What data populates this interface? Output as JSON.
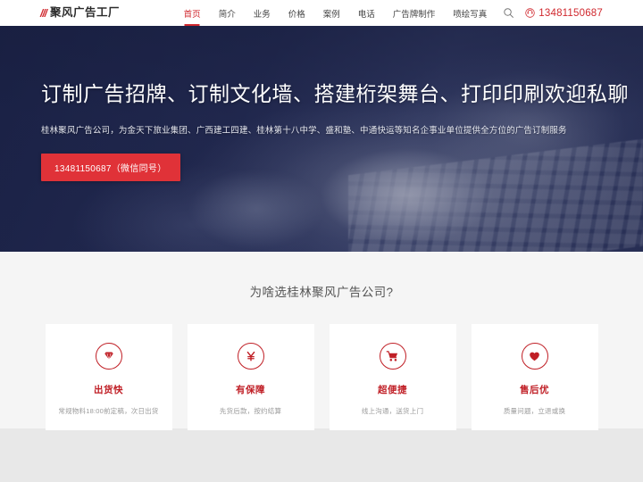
{
  "header": {
    "logo": {
      "mark": "///",
      "mark_icon": "logo-mark-icon",
      "text": "聚风广告工厂"
    },
    "nav": [
      {
        "label": "首页",
        "active": true
      },
      {
        "label": "简介",
        "active": false
      },
      {
        "label": "业务",
        "active": false
      },
      {
        "label": "价格",
        "active": false
      },
      {
        "label": "案例",
        "active": false
      },
      {
        "label": "电话",
        "active": false
      },
      {
        "label": "广告牌制作",
        "active": false
      },
      {
        "label": "喷绘写真",
        "active": false
      }
    ],
    "search_icon": "search-icon",
    "phone_icon": "phone-icon",
    "phone": "13481150687",
    "accent_color": "#d0282e"
  },
  "hero": {
    "title": "订制广告招牌、订制文化墙、搭建桁架舞台、打印印刷欢迎私聊",
    "subtitle": "桂林聚风广告公司，为金天下旅业集团、广西建工四建、桂林第十八中学、盛和塾、中通快运等知名企事业单位提供全方位的广告订制服务",
    "cta_label": "13481150687（微信同号）",
    "cta_color": "#e03238",
    "background_color": "#232a52"
  },
  "features": {
    "title": "为啥选桂林聚风广告公司?",
    "accent_color": "#c01f26",
    "cards": [
      {
        "icon": "diamond-icon",
        "title": "出货快",
        "desc": "常规物料18:00前定稿，次日出货"
      },
      {
        "icon": "yen-icon",
        "title": "有保障",
        "desc": "先货后款，按约结算"
      },
      {
        "icon": "shopping-cart-icon",
        "title": "超便捷",
        "desc": "线上沟通，送货上门"
      },
      {
        "icon": "heart-icon",
        "title": "售后优",
        "desc": "质量问题，立退或换"
      }
    ]
  }
}
